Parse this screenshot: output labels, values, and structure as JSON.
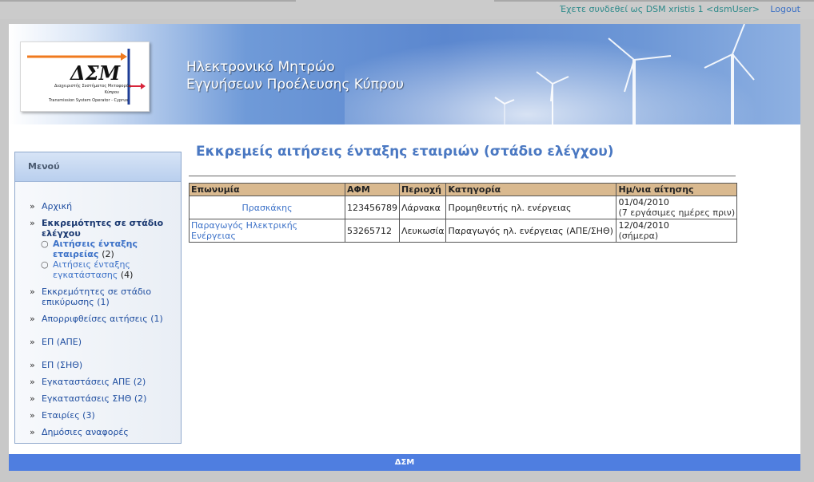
{
  "topbar": {
    "login_info": "Έχετε συνδεθεί ως DSM xristis 1 <dsmUser>",
    "logout": "Logout"
  },
  "banner": {
    "logo_abbr": "ΔΣΜ",
    "logo_line1": "Διαχειριστής Συστήματος Μεταφοράς",
    "logo_line2": "Κύπρου",
    "logo_line3": "Transmission System Operator - Cyprus",
    "title_line1": "Ηλεκτρονικό Μητρώο",
    "title_line2": "Εγγυήσεων Προέλευσης Κύπρου"
  },
  "sidebar": {
    "header": "Μενού",
    "items": [
      {
        "label": "Αρχική"
      },
      {
        "label": "Εκκρεμότητες σε στάδιο ελέγχου"
      },
      {
        "label": "Εκκρεμότητες σε στάδιο επικύρωσης (1)"
      },
      {
        "label": "Απορριφθείσες αιτήσεις (1)"
      },
      {
        "label": "ΕΠ (ΑΠΕ)"
      },
      {
        "label": "ΕΠ (ΣΗΘ)"
      },
      {
        "label": "Εγκαταστάσεις ΑΠΕ (2)"
      },
      {
        "label": "Εγκαταστάσεις ΣΗΘ (2)"
      },
      {
        "label": "Εταιρίες (3)"
      },
      {
        "label": "Δημόσιες αναφορές"
      }
    ],
    "subitems": [
      {
        "label": "Αιτήσεις ένταξης εταιρείας",
        "count": "(2)"
      },
      {
        "label": "Αιτήσεις ένταξης εγκατάστασης",
        "count": "(4)"
      }
    ]
  },
  "main": {
    "title": "Εκκρεμείς αιτήσεις ένταξης εταιριών (στάδιο ελέγχου)",
    "columns": [
      "Επωνυμία",
      "ΑΦΜ",
      "Περιοχή",
      "Κατηγορία",
      "Ημ/νια αίτησης"
    ],
    "rows": [
      {
        "name": "Πρασκάκης",
        "afm": "123456789",
        "region": "Λάρνακα",
        "category": "Προμηθευτής ηλ. ενέργειας",
        "date": "01/04/2010",
        "date_note": "(7 εργάσιμες ημέρες πριν)"
      },
      {
        "name": "Παραγωγός Ηλεκτρικής Ενέργειας",
        "afm": "53265712",
        "region": "Λευκωσία",
        "category": "Παραγωγός ηλ. ενέργειας (ΑΠΕ/ΣΗΘ)",
        "date": "12/04/2010",
        "date_note": "(σήμερα)"
      }
    ]
  },
  "footer": {
    "text": "ΔΣΜ"
  },
  "colors": {
    "accent": "#4a78c2",
    "footer": "#4f7ee0",
    "table_header": "#d9b98f"
  }
}
